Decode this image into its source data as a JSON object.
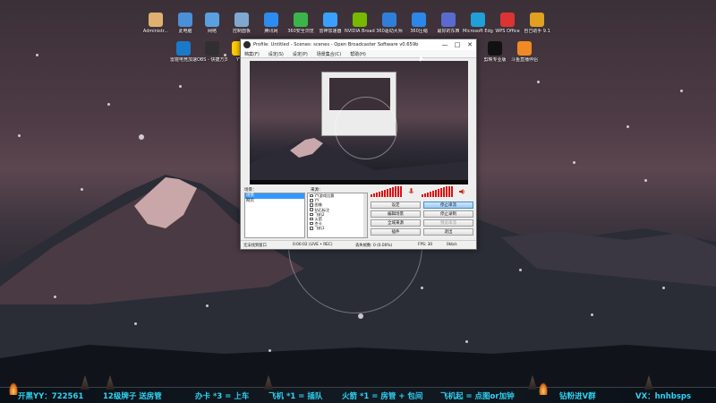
{
  "desktop_icons": [
    {
      "label": "Administr...",
      "color": "#e0b070"
    },
    {
      "label": "此电脑",
      "color": "#4a90d9"
    },
    {
      "label": "网络",
      "color": "#5aa0e0"
    },
    {
      "label": "控制面板",
      "color": "#7fa8d0"
    },
    {
      "label": "腾讯网",
      "color": "#2d8cf0"
    },
    {
      "label": "360安全浏览",
      "color": "#3bb54a"
    },
    {
      "label": "雷神加速器",
      "color": "#3aa0ff"
    },
    {
      "label": "NVIDIA Broadcast",
      "color": "#76b900"
    },
    {
      "label": "360驱动大师",
      "color": "#2f7fd8"
    },
    {
      "label": "360压缩",
      "color": "#2b88e8"
    },
    {
      "label": "最好的东西",
      "color": "#5a6bd0"
    },
    {
      "label": "Microsoft Edge",
      "color": "#1fa0d8"
    },
    {
      "label": "WPS Office",
      "color": "#d33"
    },
    {
      "label": "自己助手 9.1",
      "color": "#e0a020"
    },
    {
      "label": "雷霆电竞加速",
      "color": "#1a7ac8"
    },
    {
      "label": "OBS - 快捷方式",
      "color": "#303030"
    },
    {
      "label": "剪映专业版",
      "color": "#111111"
    },
    {
      "label": "斗鱼直播伴侣",
      "color": "#f08a24"
    },
    {
      "label": "YY",
      "color": "#ffcc00"
    }
  ],
  "obs": {
    "title": "Profile: Untitled - Scenes: scenes - Open Broadcaster Software v0.659b",
    "window_buttons": [
      "—",
      "□",
      "✕"
    ],
    "menu": [
      "档案(F)",
      "设定(S)",
      "设定(P)",
      "场景集合(C)",
      "帮助(H)"
    ],
    "scenes_label": "场景：",
    "sources_label": "来源：",
    "scenes": [
      "场景",
      "网页"
    ],
    "sources": [
      "YY游戏比赛",
      "YY",
      "图像",
      "钻石标注",
      "飞机2",
      "火箭",
      "杰卡",
      "飞机1"
    ],
    "buttons": {
      "settings": "设定",
      "stop_stream": "停止串流",
      "edit_scene": "编辑场景",
      "stop_record": "停止录制",
      "global_sources": "全域来源",
      "preview_stream": "预览串流",
      "plugins": "插件",
      "exit": "退出"
    },
    "status": {
      "left": "无法找到窗口",
      "time": "0:00:02 (LIVE • REC)",
      "dropped": "丢失帧数: 0 (0.00%)",
      "fps": "FPS: 30",
      "bitrate": "0kb/s"
    }
  },
  "banner": {
    "item1": "开黑YY：722561",
    "item2": "12级牌子 送房管",
    "item3": "办卡 *3 = 上车",
    "item4": "飞机 *1 = 插队",
    "item5": "火箭 *1 = 房管 + 包间",
    "item6": "飞机起 = 点图or加钟",
    "item7": "钻粉进V群",
    "item8": "VX：hnhbsps"
  },
  "colors": {
    "banner_text": "#2ed3f5",
    "selection": "#3399ff",
    "meter": "#dd1111"
  }
}
